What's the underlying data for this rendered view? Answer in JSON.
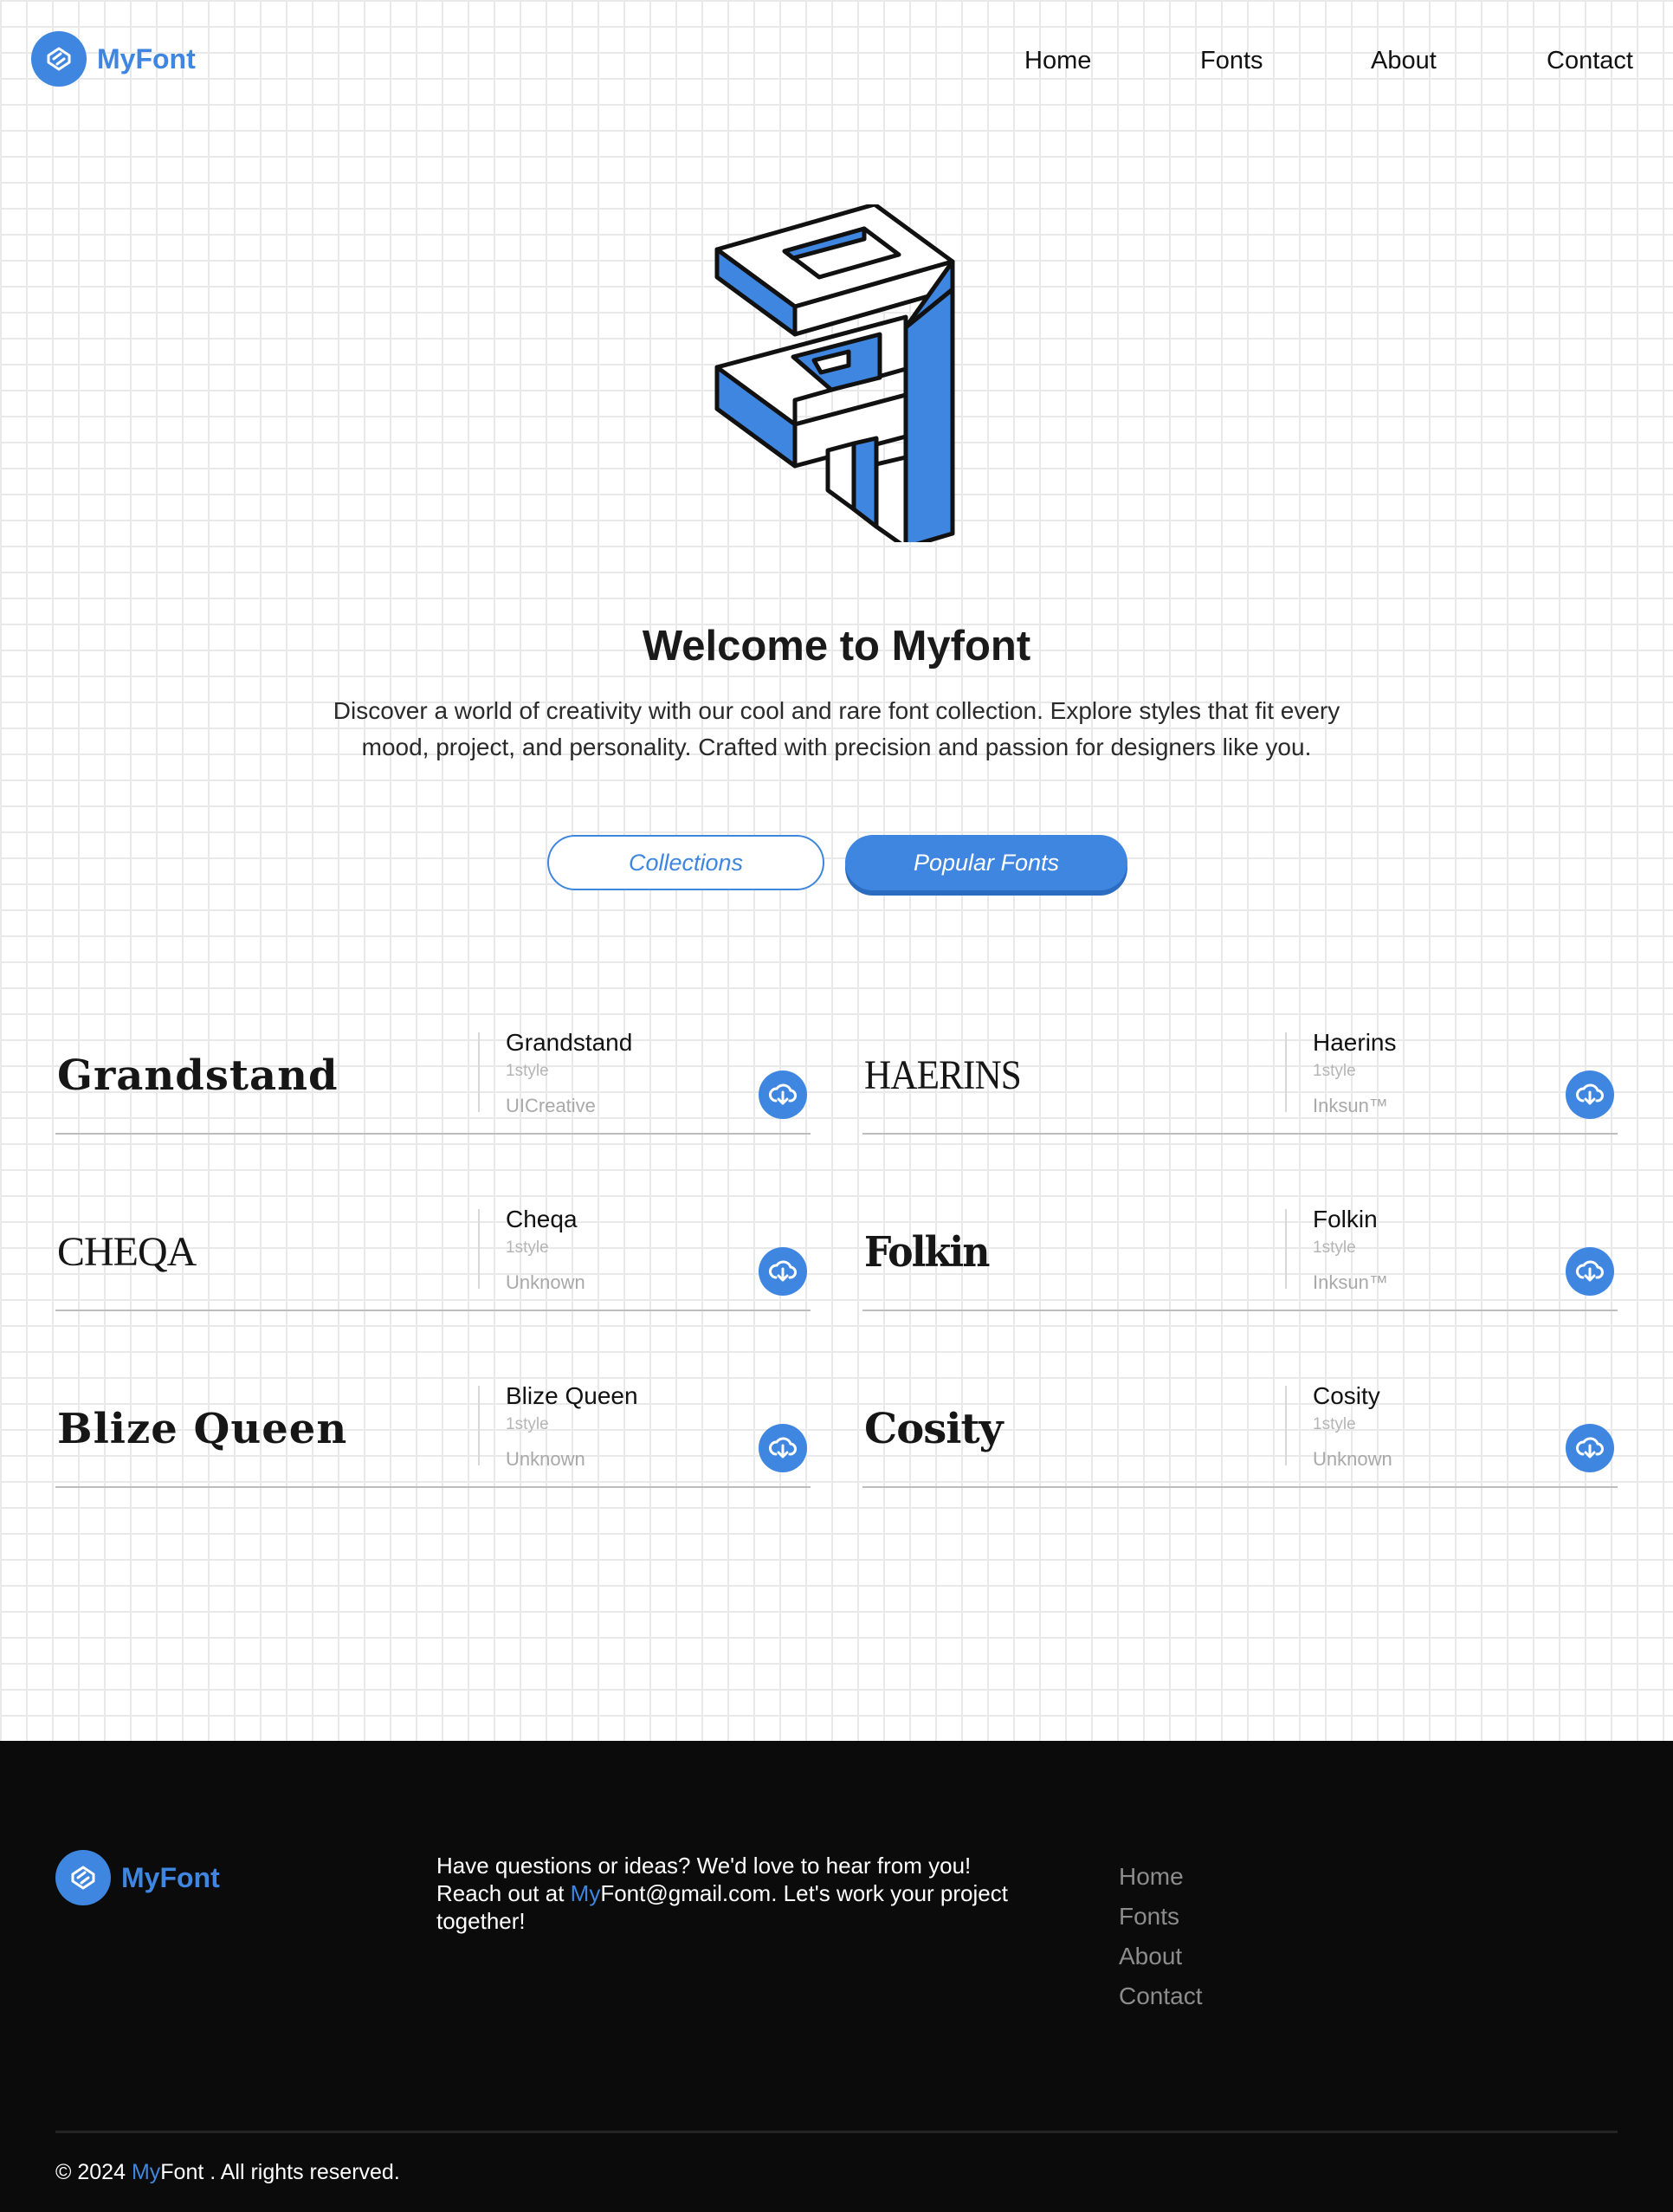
{
  "brand": {
    "name": "MyFont",
    "accent_color": "#3f86e0",
    "logo_icon": "myfont-logo-icon"
  },
  "nav": {
    "items": [
      "Home",
      "Fonts",
      "About",
      "Contact"
    ]
  },
  "hero": {
    "illustration": "isometric-letter-illustration",
    "title": "Welcome to Myfont",
    "description": "Discover a world of creativity with our cool and rare font collection. Explore styles that fit every mood, project, and personality. Crafted with precision and passion for designers like you.",
    "buttons": {
      "collections": "Collections",
      "popular": "Popular Fonts"
    }
  },
  "fonts": [
    {
      "sample": "Grandstand",
      "name": "Grandstand",
      "styles": "1style",
      "author": "UICreative",
      "icon": "download-cloud-icon"
    },
    {
      "sample": "HAERINS",
      "name": "Haerins",
      "styles": "1style",
      "author": "Inksun™",
      "icon": "download-cloud-icon"
    },
    {
      "sample": "CHEQA",
      "name": "Cheqa",
      "styles": "1style",
      "author": "Unknown",
      "icon": "download-cloud-icon"
    },
    {
      "sample": "Folkin",
      "name": "Folkin",
      "styles": "1style",
      "author": "Inksun™",
      "icon": "download-cloud-icon"
    },
    {
      "sample": "Blize Queen",
      "name": "Blize Queen",
      "styles": "1style",
      "author": "Unknown",
      "icon": "download-cloud-icon"
    },
    {
      "sample": "Cosity",
      "name": "Cosity",
      "styles": "1style",
      "author": "Unknown",
      "icon": "download-cloud-icon"
    }
  ],
  "footer": {
    "brand": "MyFont",
    "message_line1": "Have questions or ideas? We'd love to hear from you!",
    "message_reach": "Reach out at ",
    "email_accent": "My",
    "email_rest": "Font@gmail.com. Let's work your project together!",
    "links": [
      "Home",
      "Fonts",
      "About",
      "Contact"
    ],
    "copyright_prefix": "© 2024 ",
    "copyright_accent": "My",
    "copyright_rest": "Font . All rights reserved."
  }
}
